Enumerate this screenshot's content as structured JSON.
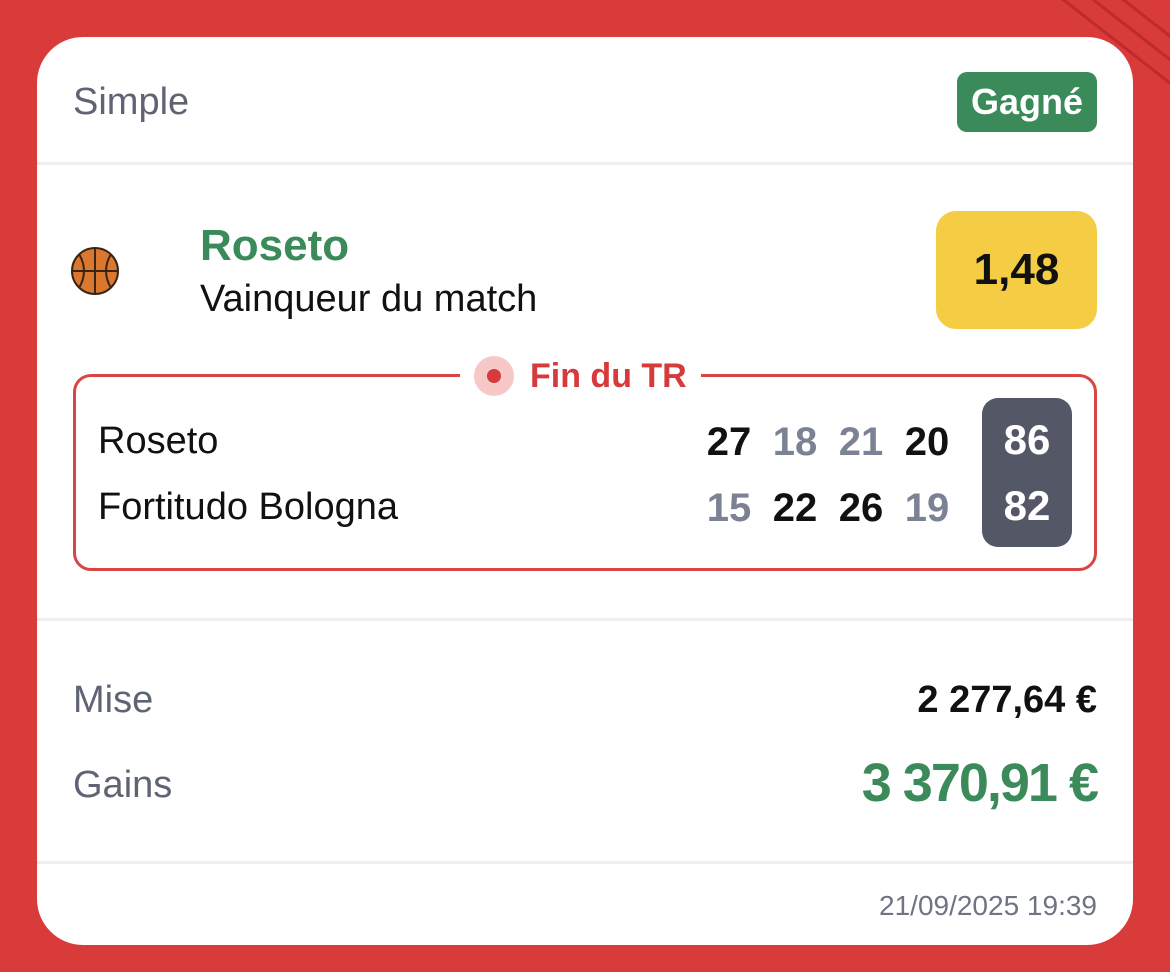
{
  "card": {
    "bet_type": "Simple",
    "status": "Gagné",
    "sport_icon": "basketball-icon",
    "selection": "Roseto",
    "market": "Vainqueur du match",
    "odds": "1,48"
  },
  "score": {
    "live_label": "Fin du TR",
    "teams": [
      {
        "name": "Roseto",
        "periods": [
          "27",
          "18",
          "21",
          "20"
        ],
        "total": "86"
      },
      {
        "name": "Fortitudo Bologna",
        "periods": [
          "15",
          "22",
          "26",
          "19"
        ],
        "total": "82"
      }
    ]
  },
  "summary": {
    "stake_label": "Mise",
    "stake_value": "2 277,64 €",
    "gains_label": "Gains",
    "gains_value": "3 370,91 €"
  },
  "footer": {
    "timestamp": "21/09/2025 19:39"
  },
  "colors": {
    "background": "#d93a3a",
    "win_green": "#3b8a5a",
    "odds_yellow": "#f5cd45",
    "live_red": "#d63a3a",
    "total_bg": "#545765"
  }
}
